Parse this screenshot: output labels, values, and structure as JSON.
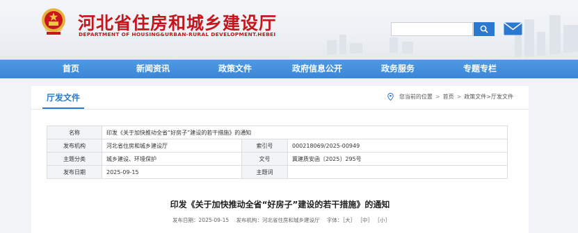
{
  "header": {
    "title_zh": "河北省住房和城乡建设厅",
    "title_en": "DEPARTMENT OF HOUSING&URBAN-RURAL DEVELOPMENT.HEBEI",
    "search_placeholder": ""
  },
  "nav": [
    "首页",
    "新闻资讯",
    "政策文件",
    "政府信息公开",
    "政务服务",
    "专题专栏"
  ],
  "section": {
    "tab": "厅发文件",
    "breadcrumb": {
      "label": "您当前的位置",
      "home": "首页",
      "path": "政策文件>厅发文件"
    }
  },
  "meta": {
    "name_key": "名称",
    "name_value": "印发《关于加快推动全省“好房子”建设的若干措施》的通知",
    "org_key": "发布机构",
    "org_value": "河北省住房和城乡建设厅",
    "index_key": "索引号",
    "index_value": "000218069/2025-00949",
    "topic_key": "主题分类",
    "topic_value": "城乡建设、环境保护",
    "docno_key": "文号",
    "docno_value": "冀建质安函〔2025〕295号",
    "date_key": "发布日期",
    "date_value": "2025-09-15",
    "keyword_key": "主题词",
    "keyword_value": ""
  },
  "document": {
    "title": "印发《关于加快推动全省“好房子”建设的若干措施》的通知",
    "date_label": "发布日期：2025-09-15",
    "org_label": "发布机构：河北省住房和城乡建设厅",
    "font_label": "字体：",
    "font_large": "［大］",
    "font_medium": "［中］",
    "font_small": "［小］"
  },
  "colors": {
    "brand_red": "#c4161c",
    "nav_blue": "#3a86d6",
    "accent": "#2b78d0"
  },
  "icons": [
    "national-emblem-icon",
    "search-icon",
    "mail-icon",
    "location-pin-icon"
  ]
}
